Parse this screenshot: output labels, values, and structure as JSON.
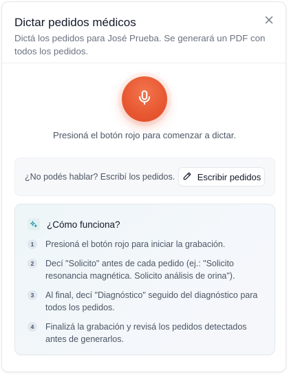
{
  "dialog": {
    "title": "Dictar pedidos médicos",
    "subtitle": "Dictá los pedidos para José Prueba. Se generará un PDF con todos los pedidos.",
    "close_icon": "close-icon"
  },
  "recorder": {
    "mic_icon": "microphone-icon",
    "hint": "Presioná el botón rojo para comenzar a dictar.",
    "accent": "#e85a33"
  },
  "write": {
    "question": "¿No podés hablar? Escribí los pedidos.",
    "button_label": "Escribir pedidos",
    "button_icon": "pencil-icon"
  },
  "how": {
    "icon": "sparkles-icon",
    "title": "¿Cómo funciona?",
    "steps": [
      {
        "num": "1",
        "text": "Presioná el botón rojo para iniciar la grabación."
      },
      {
        "num": "2",
        "text": "Decí \"Solicito\" antes de cada pedido (ej.: \"Solicito resonancia magnética. Solicito análisis de orina\")."
      },
      {
        "num": "3",
        "text": "Al final, decí \"Diagnóstico\" seguido del diagnóstico para todos los pedidos."
      },
      {
        "num": "4",
        "text": "Finalizá la grabación y revisá los pedidos detectados antes de generarlos."
      }
    ]
  }
}
